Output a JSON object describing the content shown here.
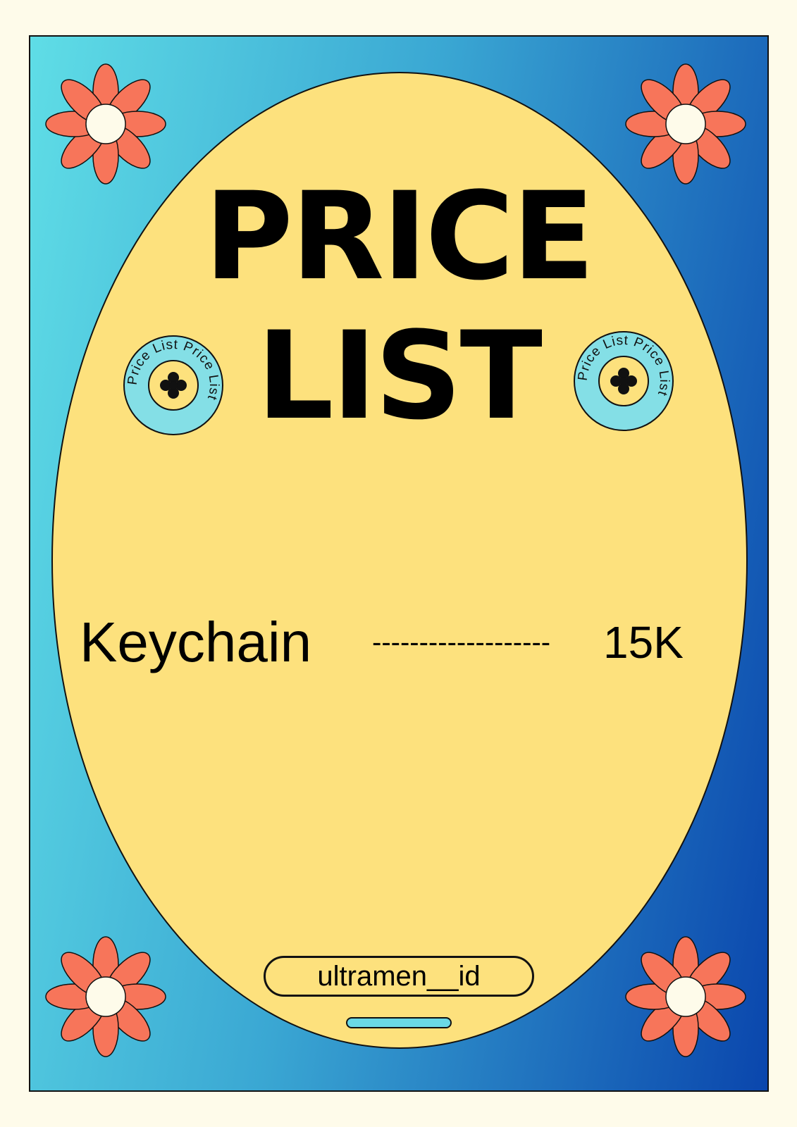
{
  "title": {
    "line1": "PRICE",
    "line2": "LIST"
  },
  "badge": {
    "text": "Price List Price List"
  },
  "items": [
    {
      "name": "Keychain",
      "leader": "-------------------",
      "price": "15K"
    }
  ],
  "footer": {
    "handle": "ultramen__id"
  },
  "colors": {
    "background": "#fefbea",
    "oval": "#fde17d",
    "petal": "#f7755a",
    "gradient_start": "#5fdde6",
    "gradient_end": "#0a46ad",
    "badge": "#84dfe6"
  },
  "icons": [
    "flower-icon",
    "clover-icon"
  ]
}
